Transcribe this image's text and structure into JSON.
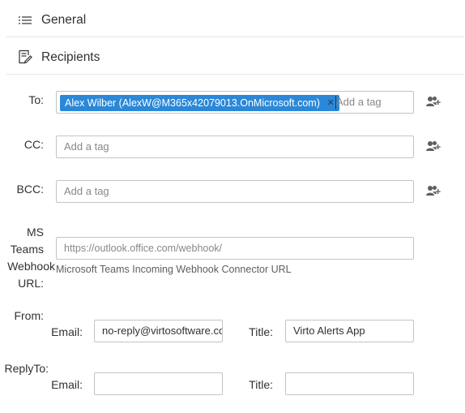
{
  "general": {
    "title": "General",
    "icon": "list-icon"
  },
  "recipients": {
    "title": "Recipients",
    "icon": "edit-icon",
    "to": {
      "label": "To:",
      "tag": "Alex Wilber (AlexW@M365x42079013.OnMicrosoft.com)",
      "placeholder": "Add a tag"
    },
    "cc": {
      "label": "CC:",
      "placeholder": "Add a tag"
    },
    "bcc": {
      "label": "BCC:",
      "placeholder": "Add a tag"
    },
    "teams": {
      "label_lines": [
        "MS",
        "Teams",
        "Webhook",
        "URL:"
      ],
      "placeholder": "https://outlook.office.com/webhook/",
      "hint": "Microsoft Teams Incoming Webhook Connector URL"
    },
    "from": {
      "label": "From:",
      "email_label": "Email:",
      "email_value": "no-reply@virtosoftware.com",
      "title_label": "Title:",
      "title_value": "Virto Alerts App"
    },
    "reply_to": {
      "label": "ReplyTo:",
      "email_label": "Email:",
      "email_value": "",
      "title_label": "Title:",
      "title_value": ""
    }
  }
}
